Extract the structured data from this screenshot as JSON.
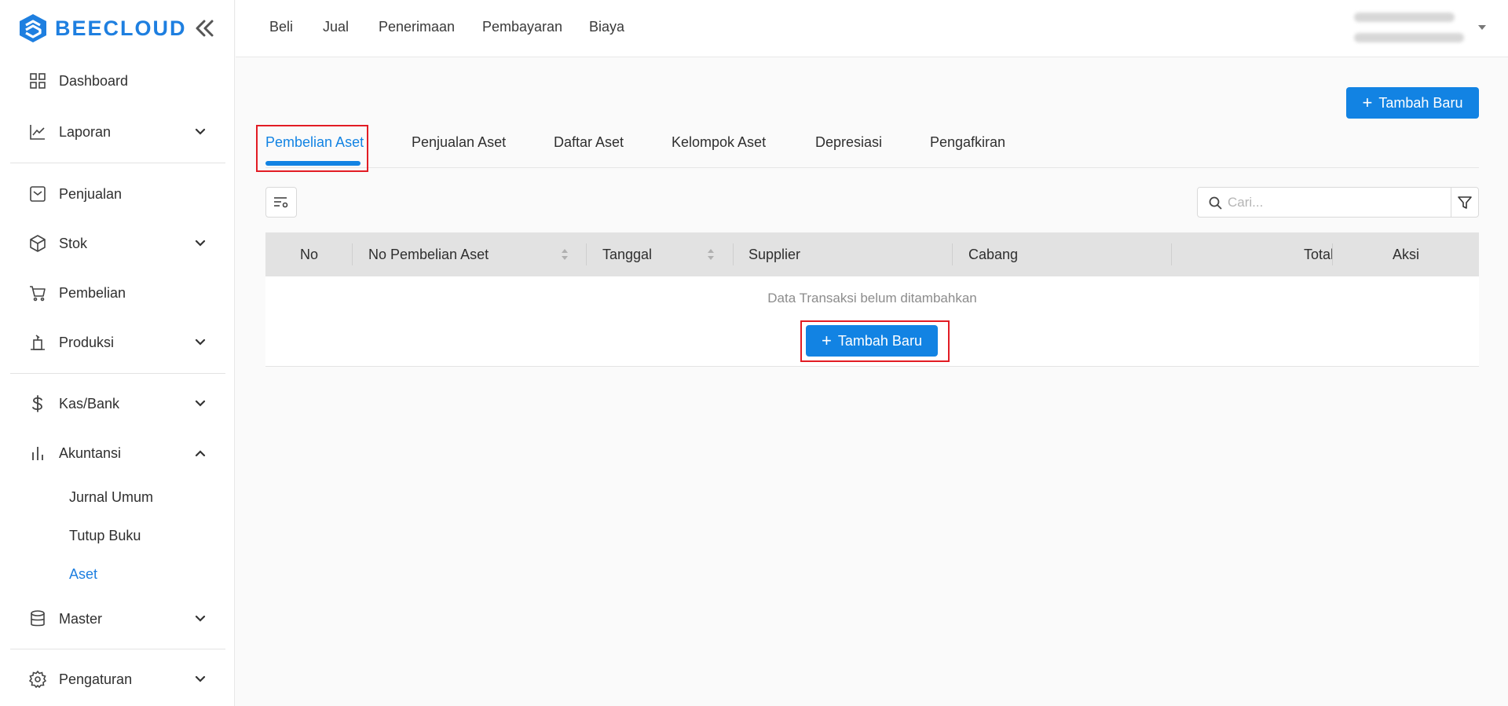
{
  "brand": {
    "name": "BEECLOUD",
    "color": "#1e7fe0"
  },
  "sidebar": {
    "items": [
      {
        "label": "Dashboard",
        "icon": "dashboard-grid-icon"
      },
      {
        "label": "Laporan",
        "icon": "chart-line-icon",
        "expandable": true
      },
      {
        "label": "Penjualan",
        "icon": "receipt-icon"
      },
      {
        "label": "Stok",
        "icon": "box-icon",
        "expandable": true
      },
      {
        "label": "Pembelian",
        "icon": "cart-icon"
      },
      {
        "label": "Produksi",
        "icon": "factory-icon",
        "expandable": true
      },
      {
        "label": "Kas/Bank",
        "icon": "dollar-icon",
        "expandable": true
      },
      {
        "label": "Akuntansi",
        "icon": "bar-chart-icon",
        "expandable": true,
        "expanded": true
      },
      {
        "label": "Master",
        "icon": "database-icon",
        "expandable": true
      },
      {
        "label": "Pengaturan",
        "icon": "gear-icon",
        "expandable": true
      }
    ],
    "akuntansi_sub": [
      "Jurnal Umum",
      "Tutup Buku",
      "Aset"
    ],
    "active_sub": "Aset"
  },
  "topnav": [
    "Beli",
    "Jual",
    "Penerimaan",
    "Pembayaran",
    "Biaya"
  ],
  "actions": {
    "add_new_label": "Tambah Baru"
  },
  "tabs": [
    "Pembelian Aset",
    "Penjualan Aset",
    "Daftar Aset",
    "Kelompok Aset",
    "Depresiasi",
    "Pengafkiran"
  ],
  "active_tab": "Pembelian Aset",
  "search": {
    "placeholder": "Cari..."
  },
  "table": {
    "columns": [
      "No",
      "No Pembelian Aset",
      "Tanggal",
      "Supplier",
      "Cabang",
      "Total",
      "Aksi"
    ],
    "empty_message": "Data Transaksi belum ditambahkan",
    "empty_add_label": "Tambah Baru"
  },
  "colors": {
    "primary": "#1283e3",
    "highlight": "#e21c24"
  }
}
